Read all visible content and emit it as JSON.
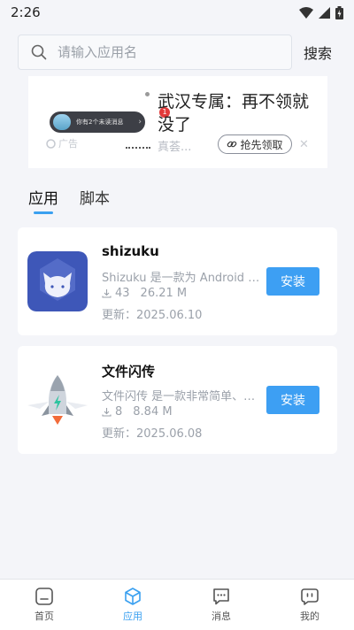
{
  "status_bar": {
    "time": "2:26"
  },
  "search": {
    "placeholder": "请输入应用名",
    "button_label": "搜索"
  },
  "ad": {
    "title": "武汉专属：再不领就没了",
    "subtitle": "真荟...",
    "cta_label": "抢先领取",
    "label": "广告",
    "notify_text": "你有2个未读消息",
    "badge_count": "1",
    "close_glyph": "✕"
  },
  "tabs": [
    {
      "label": "应用",
      "active": true
    },
    {
      "label": "脚本",
      "active": false
    }
  ],
  "apps": [
    {
      "name": "shizuku",
      "description": "Shizuku 是一款为 Android 设备开发的工具",
      "downloads": "43",
      "size": "26.21 M",
      "updated": "更新：2025.06.10",
      "install_label": "安装",
      "icon": "shizuku-app-icon"
    },
    {
      "name": "文件闪传",
      "description": "文件闪传 是一款非常简单、快速的传输工具",
      "downloads": "8",
      "size": "8.84 M",
      "updated": "更新：2025.06.08",
      "install_label": "安装",
      "icon": "rocket-app-icon"
    }
  ],
  "bottom_nav": [
    {
      "label": "首页",
      "icon": "home-icon",
      "active": false
    },
    {
      "label": "应用",
      "icon": "cube-icon",
      "active": true
    },
    {
      "label": "消息",
      "icon": "message-icon",
      "active": false
    },
    {
      "label": "我的",
      "icon": "profile-icon",
      "active": false
    }
  ],
  "colors": {
    "accent": "#3aa0f0",
    "install": "#3d9ff3",
    "background": "#f4f5f9"
  }
}
